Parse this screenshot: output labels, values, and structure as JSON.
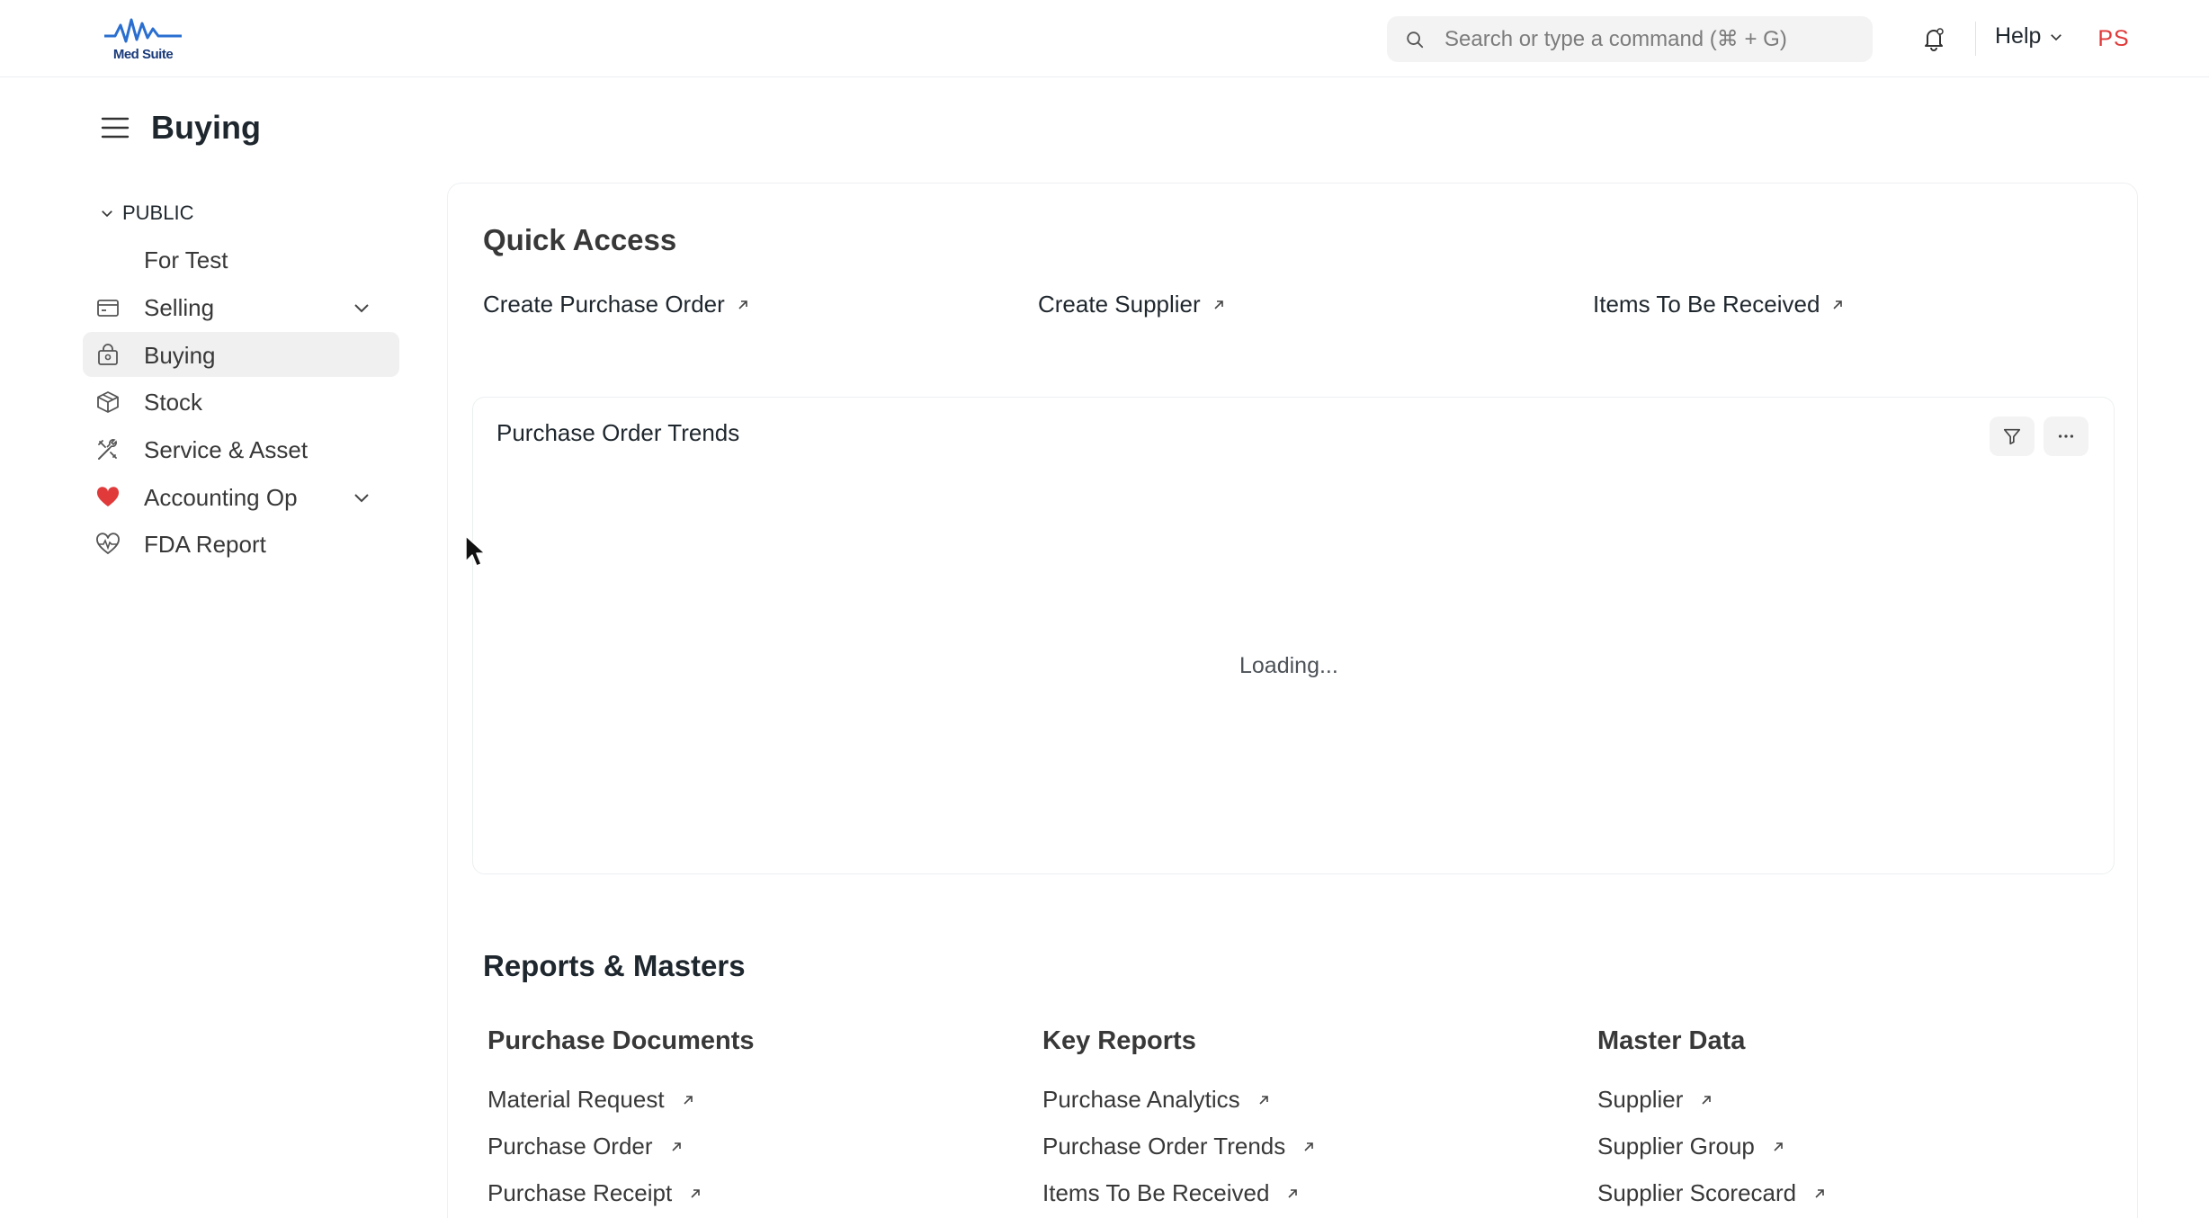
{
  "navbar": {
    "logo_text": "Med Suite",
    "search_placeholder": "Search or type a command (⌘ + G)",
    "help_label": "Help",
    "avatar_initials": "PS"
  },
  "page": {
    "title": "Buying"
  },
  "sidebar": {
    "section_label": "PUBLIC",
    "items": [
      {
        "label": "For Test",
        "icon": "none"
      },
      {
        "label": "Selling",
        "icon": "wallet-icon",
        "has_children": true
      },
      {
        "label": "Buying",
        "icon": "bag-icon",
        "active": true
      },
      {
        "label": "Stock",
        "icon": "box-icon"
      },
      {
        "label": "Service & Asset",
        "icon": "tools-icon"
      },
      {
        "label": "Accounting Op",
        "icon": "heart-icon",
        "has_children": true
      },
      {
        "label": "FDA Report",
        "icon": "heart-pulse-icon"
      }
    ]
  },
  "quick_access": {
    "title": "Quick Access",
    "links": [
      "Create Purchase Order",
      "Create Supplier",
      "Items To Be Received"
    ]
  },
  "chart_card": {
    "title": "Purchase Order Trends",
    "status": "Loading..."
  },
  "reports": {
    "title": "Reports & Masters",
    "columns": [
      {
        "heading": "Purchase Documents",
        "links": [
          "Material Request",
          "Purchase Order",
          "Purchase Receipt"
        ]
      },
      {
        "heading": "Key Reports",
        "links": [
          "Purchase Analytics",
          "Purchase Order Trends",
          "Items To Be Received"
        ]
      },
      {
        "heading": "Master Data",
        "links": [
          "Supplier",
          "Supplier Group",
          "Supplier Scorecard"
        ]
      }
    ]
  },
  "colors": {
    "accent_red": "#e03a3a",
    "active_bg": "#f0f0f0",
    "logo_blue": "#1a3a7a"
  }
}
